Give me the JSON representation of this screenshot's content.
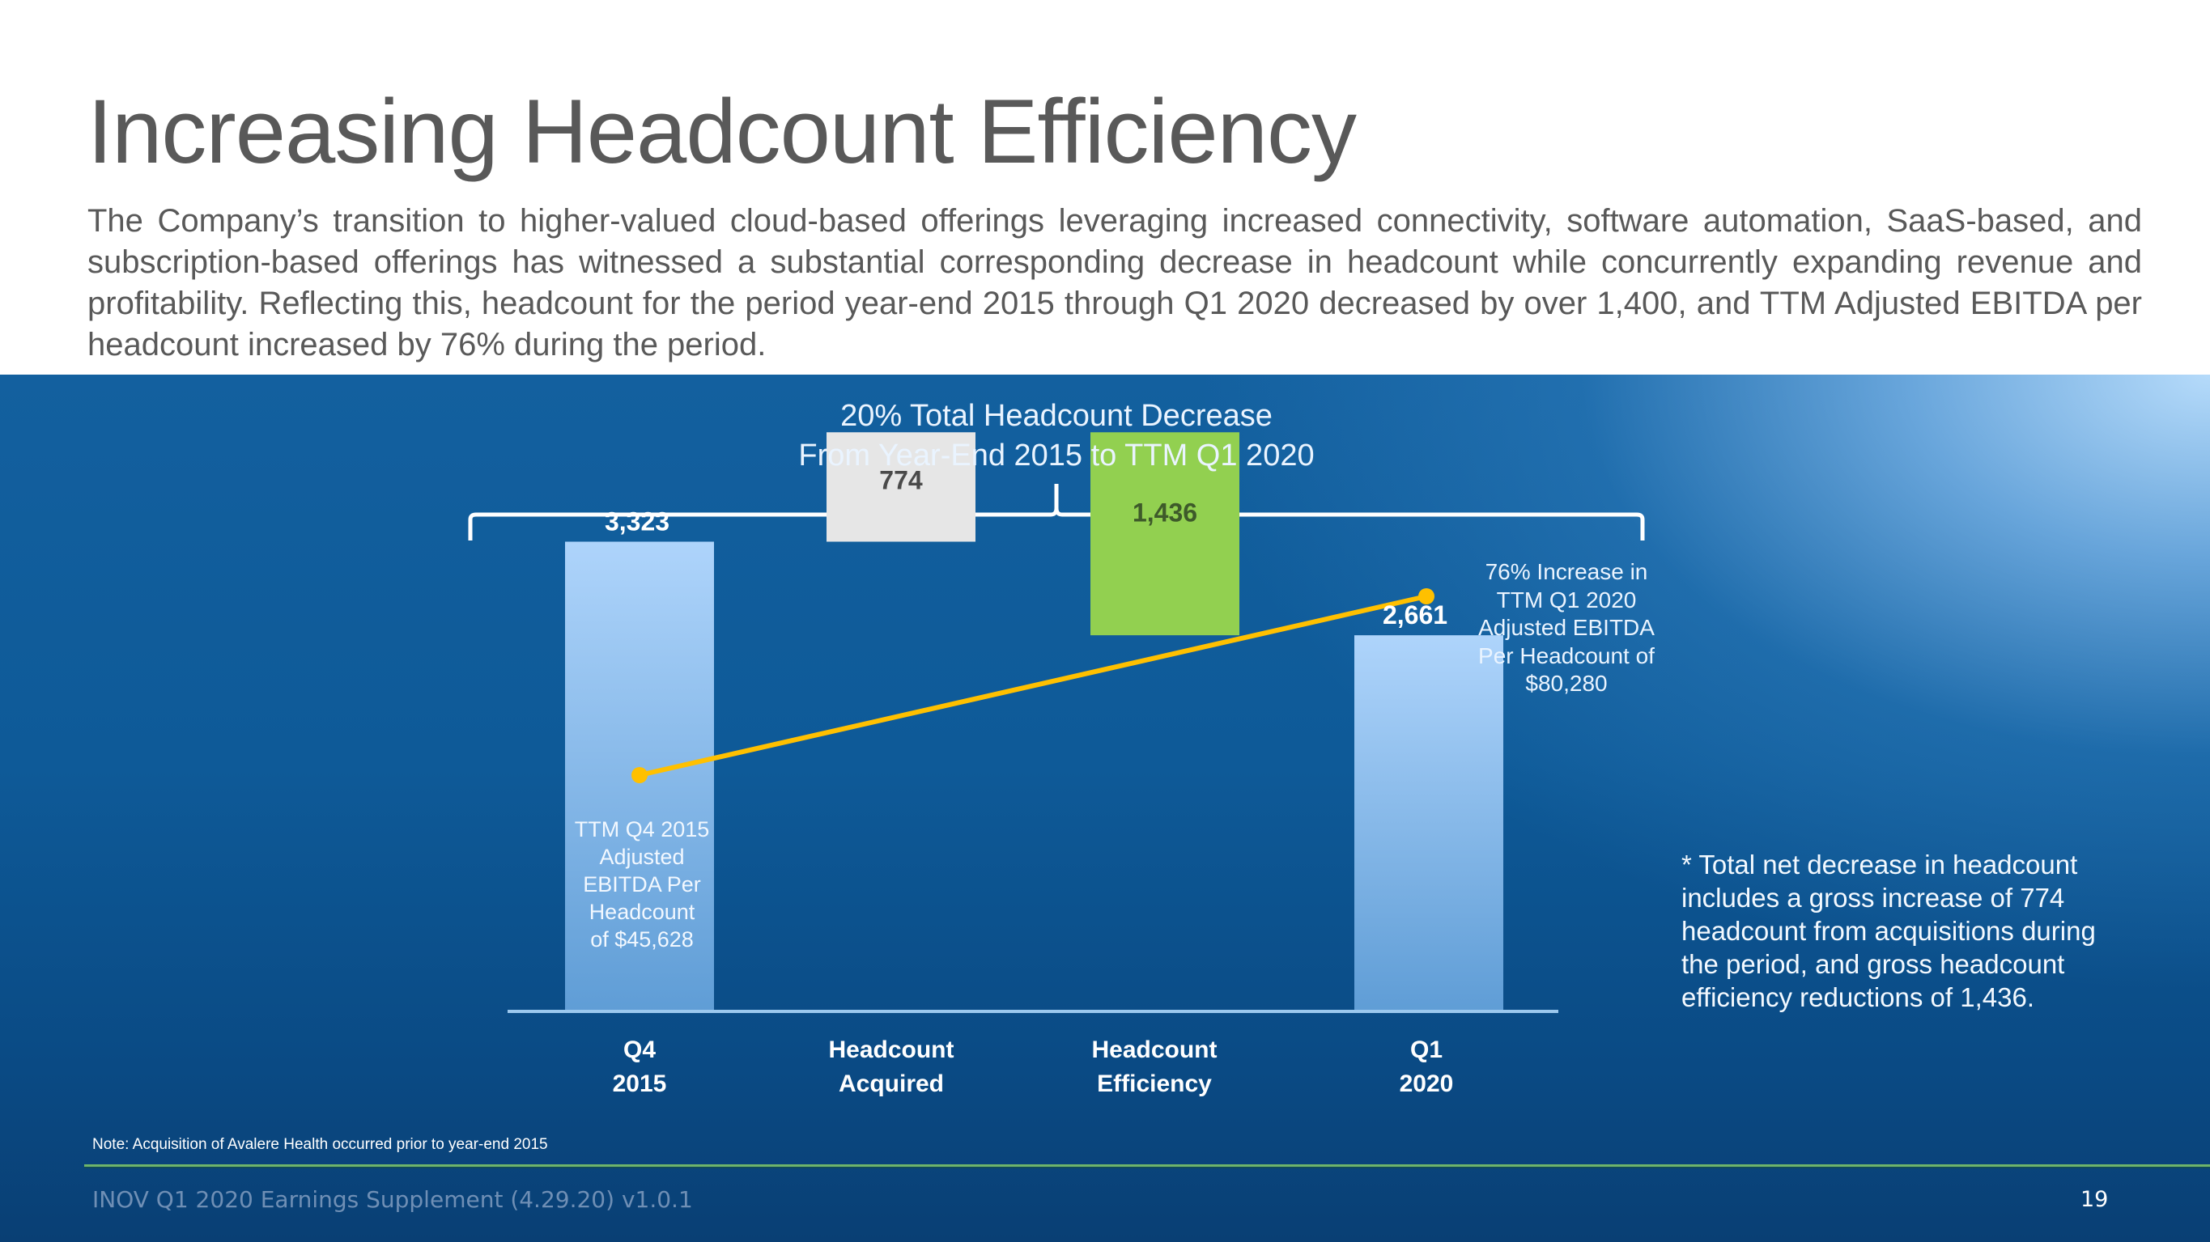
{
  "slide": {
    "title": "Increasing Headcount Efficiency",
    "intro": "The Company’s transition to higher-valued cloud-based offerings leveraging increased connectivity, software automation, SaaS-based, and subscription-based offerings has witnessed a substantial corresponding decrease in headcount while concurrently expanding revenue and profitability. Reflecting this, headcount for the period year-end 2015 through Q1 2020 decreased by over 1,400, and TTM Adjusted EBITDA per headcount increased by 76% during the period.",
    "footnote": "* Total net decrease in headcount includes a gross increase of 774 headcount from acquisitions during the period, and gross headcount efficiency reductions of 1,436.",
    "note": "Note: Acquisition of Avalere Health occurred prior to year-end 2015",
    "footer": "INOV Q1 2020 Earnings Supplement (4.29.20) v1.0.1",
    "page_number": "19"
  },
  "colors": {
    "total_bar": "#aed4fb",
    "acquired_bar": "#e6e6e6",
    "efficiency_bar": "#92d050",
    "ebitda_line": "#ffc000",
    "title_text": "#595959"
  },
  "chart_data": {
    "type": "bar",
    "subtype": "waterfall",
    "title": "20% Total Headcount Decrease",
    "subtitle": "From Year-End 2015 to TTM Q1 2020",
    "categories": [
      "Q4 2015",
      "Headcount Acquired",
      "Headcount Efficiency",
      "Q1 2020"
    ],
    "category_lines": [
      [
        "Q4",
        "2015"
      ],
      [
        "Headcount",
        "Acquired"
      ],
      [
        "Headcount",
        "Efficiency"
      ],
      [
        "Q1",
        "2020"
      ]
    ],
    "series": [
      {
        "name": "Headcount",
        "values": [
          3323,
          774,
          -1436,
          2661
        ],
        "kinds": [
          "total",
          "increase",
          "decrease",
          "total"
        ],
        "labels": [
          "3,323",
          "774",
          "1,436",
          "2,661"
        ]
      }
    ],
    "overlay_line": {
      "name": "TTM Adjusted EBITDA Per Headcount",
      "x": [
        "Q4 2015",
        "Q1 2020"
      ],
      "values": [
        45628,
        80280
      ],
      "unit": "$"
    },
    "annotations": {
      "start": [
        "TTM Q4 2015",
        "Adjusted",
        "EBITDA Per",
        "Headcount",
        "of $45,628"
      ],
      "end": [
        "76% Increase in",
        "TTM Q1 2020",
        "Adjusted EBITDA",
        "Per Headcount of",
        "$80,280"
      ]
    },
    "ylim": [
      0,
      4150
    ],
    "xlabel": "",
    "ylabel": "",
    "grid": false,
    "legend": "none"
  }
}
